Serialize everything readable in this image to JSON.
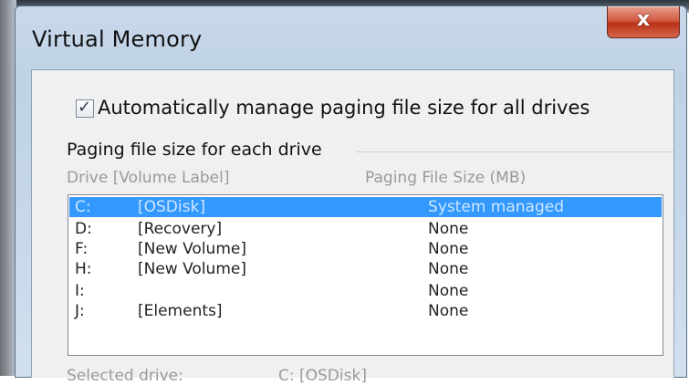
{
  "window": {
    "title": "Virtual Memory",
    "close_glyph": "x"
  },
  "auto_manage": {
    "checked": true,
    "label": "Automatically manage paging file size for all drives"
  },
  "paging_group": {
    "label": "Paging file size for each drive",
    "columns": {
      "drive": "Drive  [Volume Label]",
      "size": "Paging File Size (MB)"
    },
    "rows": [
      {
        "drive": "C:",
        "label": "[OSDisk]",
        "size": "System managed",
        "selected": true
      },
      {
        "drive": "D:",
        "label": "[Recovery]",
        "size": "None",
        "selected": false
      },
      {
        "drive": "F:",
        "label": "[New Volume]",
        "size": "None",
        "selected": false
      },
      {
        "drive": "H:",
        "label": "[New Volume]",
        "size": "None",
        "selected": false
      },
      {
        "drive": "I:",
        "label": "",
        "size": "None",
        "selected": false
      },
      {
        "drive": "J:",
        "label": "[Elements]",
        "size": "None",
        "selected": false
      }
    ]
  },
  "selected_drive": {
    "label": "Selected drive:",
    "value": "C:  [OSDisk]"
  }
}
